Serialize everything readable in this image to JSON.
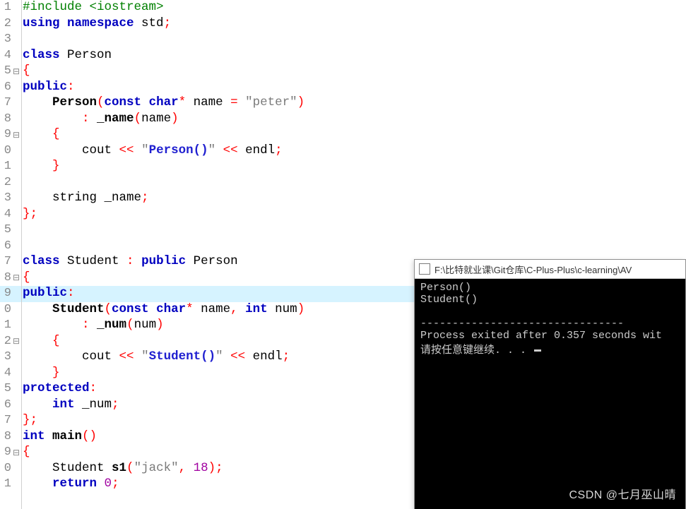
{
  "watermark": "CSDN @七月巫山晴",
  "console": {
    "title": "F:\\比特就业课\\Git仓库\\C-Plus-Plus\\c-learning\\AV",
    "lines": [
      "Person()",
      "Student()",
      "--------------------------------",
      "Process exited after 0.357 seconds wit",
      "请按任意键继续. . . "
    ]
  },
  "code": {
    "highlight_line": 19,
    "lines": [
      {
        "n": "1",
        "fold": "",
        "tokens": [
          [
            "pre",
            "#include <iostream>"
          ]
        ]
      },
      {
        "n": "2",
        "fold": "",
        "tokens": [
          [
            "kw",
            "using"
          ],
          [
            "id",
            " "
          ],
          [
            "kw",
            "namespace"
          ],
          [
            "id",
            " std"
          ],
          [
            "op",
            ";"
          ]
        ]
      },
      {
        "n": "3",
        "fold": "",
        "tokens": []
      },
      {
        "n": "4",
        "fold": "",
        "tokens": [
          [
            "kw",
            "class"
          ],
          [
            "id",
            " Person"
          ]
        ]
      },
      {
        "n": "5",
        "fold": "⊟",
        "tokens": [
          [
            "br",
            "{"
          ]
        ]
      },
      {
        "n": "6",
        "fold": "",
        "tokens": [
          [
            "kw",
            "public"
          ],
          [
            "op",
            ":"
          ]
        ]
      },
      {
        "n": "7",
        "fold": "",
        "tokens": [
          [
            "id",
            "    "
          ],
          [
            "fn",
            "Person"
          ],
          [
            "br",
            "("
          ],
          [
            "kw",
            "const"
          ],
          [
            "id",
            " "
          ],
          [
            "kw",
            "char"
          ],
          [
            "op",
            "*"
          ],
          [
            "id",
            " name "
          ],
          [
            "op",
            "="
          ],
          [
            "id",
            " "
          ],
          [
            "str",
            "\"peter\""
          ],
          [
            "br",
            ")"
          ]
        ]
      },
      {
        "n": "8",
        "fold": "",
        "tokens": [
          [
            "id",
            "        "
          ],
          [
            "op",
            ":"
          ],
          [
            "id",
            " "
          ],
          [
            "fn",
            "_name"
          ],
          [
            "br",
            "("
          ],
          [
            "id",
            "name"
          ],
          [
            "br",
            ")"
          ]
        ]
      },
      {
        "n": "9",
        "fold": "⊟",
        "tokens": [
          [
            "id",
            "    "
          ],
          [
            "br",
            "{"
          ]
        ]
      },
      {
        "n": "0",
        "fold": "",
        "tokens": [
          [
            "id",
            "        cout "
          ],
          [
            "op",
            "<<"
          ],
          [
            "id",
            " "
          ],
          [
            "str",
            "\""
          ],
          [
            "blue",
            "Person()"
          ],
          [
            "str",
            "\""
          ],
          [
            "id",
            " "
          ],
          [
            "op",
            "<<"
          ],
          [
            "id",
            " endl"
          ],
          [
            "op",
            ";"
          ]
        ]
      },
      {
        "n": "1",
        "fold": "",
        "tokens": [
          [
            "id",
            "    "
          ],
          [
            "br",
            "}"
          ]
        ]
      },
      {
        "n": "2",
        "fold": "",
        "tokens": []
      },
      {
        "n": "3",
        "fold": "",
        "tokens": [
          [
            "id",
            "    string _name"
          ],
          [
            "op",
            ";"
          ]
        ]
      },
      {
        "n": "4",
        "fold": "",
        "tokens": [
          [
            "br",
            "}"
          ],
          [
            "op",
            ";"
          ]
        ]
      },
      {
        "n": "5",
        "fold": "",
        "tokens": []
      },
      {
        "n": "6",
        "fold": "",
        "tokens": []
      },
      {
        "n": "7",
        "fold": "",
        "tokens": [
          [
            "kw",
            "class"
          ],
          [
            "id",
            " Student "
          ],
          [
            "op",
            ":"
          ],
          [
            "id",
            " "
          ],
          [
            "kw",
            "public"
          ],
          [
            "id",
            " Person"
          ]
        ]
      },
      {
        "n": "8",
        "fold": "⊟",
        "tokens": [
          [
            "br",
            "{"
          ]
        ]
      },
      {
        "n": "9",
        "fold": "",
        "tokens": [
          [
            "kw",
            "public"
          ],
          [
            "op",
            ":"
          ]
        ]
      },
      {
        "n": "0",
        "fold": "",
        "tokens": [
          [
            "id",
            "    "
          ],
          [
            "fn",
            "Student"
          ],
          [
            "br",
            "("
          ],
          [
            "kw",
            "const"
          ],
          [
            "id",
            " "
          ],
          [
            "kw",
            "char"
          ],
          [
            "op",
            "*"
          ],
          [
            "id",
            " name"
          ],
          [
            "op",
            ","
          ],
          [
            "id",
            " "
          ],
          [
            "kw",
            "int"
          ],
          [
            "id",
            " num"
          ],
          [
            "br",
            ")"
          ]
        ]
      },
      {
        "n": "1",
        "fold": "",
        "tokens": [
          [
            "id",
            "        "
          ],
          [
            "op",
            ":"
          ],
          [
            "id",
            " "
          ],
          [
            "fn",
            "_num"
          ],
          [
            "br",
            "("
          ],
          [
            "id",
            "num"
          ],
          [
            "br",
            ")"
          ]
        ]
      },
      {
        "n": "2",
        "fold": "⊟",
        "tokens": [
          [
            "id",
            "    "
          ],
          [
            "br",
            "{"
          ]
        ]
      },
      {
        "n": "3",
        "fold": "",
        "tokens": [
          [
            "id",
            "        cout "
          ],
          [
            "op",
            "<<"
          ],
          [
            "id",
            " "
          ],
          [
            "str",
            "\""
          ],
          [
            "blue",
            "Student()"
          ],
          [
            "str",
            "\""
          ],
          [
            "id",
            " "
          ],
          [
            "op",
            "<<"
          ],
          [
            "id",
            " endl"
          ],
          [
            "op",
            ";"
          ]
        ]
      },
      {
        "n": "4",
        "fold": "",
        "tokens": [
          [
            "id",
            "    "
          ],
          [
            "br",
            "}"
          ]
        ]
      },
      {
        "n": "5",
        "fold": "",
        "tokens": [
          [
            "kw",
            "protected"
          ],
          [
            "op",
            ":"
          ]
        ]
      },
      {
        "n": "6",
        "fold": "",
        "tokens": [
          [
            "id",
            "    "
          ],
          [
            "kw",
            "int"
          ],
          [
            "id",
            " _num"
          ],
          [
            "op",
            ";"
          ]
        ]
      },
      {
        "n": "7",
        "fold": "",
        "tokens": [
          [
            "br",
            "}"
          ],
          [
            "op",
            ";"
          ]
        ]
      },
      {
        "n": "8",
        "fold": "",
        "tokens": [
          [
            "kw",
            "int"
          ],
          [
            "id",
            " "
          ],
          [
            "fn",
            "main"
          ],
          [
            "br",
            "()"
          ]
        ]
      },
      {
        "n": "9",
        "fold": "⊟",
        "tokens": [
          [
            "br",
            "{"
          ]
        ]
      },
      {
        "n": "0",
        "fold": "",
        "tokens": [
          [
            "id",
            "    Student "
          ],
          [
            "fn",
            "s1"
          ],
          [
            "br",
            "("
          ],
          [
            "str",
            "\"jack\""
          ],
          [
            "op",
            ","
          ],
          [
            "id",
            " "
          ],
          [
            "num",
            "18"
          ],
          [
            "br",
            ")"
          ],
          [
            "op",
            ";"
          ]
        ]
      },
      {
        "n": "1",
        "fold": "",
        "tokens": [
          [
            "id",
            "    "
          ],
          [
            "kw",
            "return"
          ],
          [
            "id",
            " "
          ],
          [
            "num",
            "0"
          ],
          [
            "op",
            ";"
          ]
        ]
      }
    ]
  }
}
